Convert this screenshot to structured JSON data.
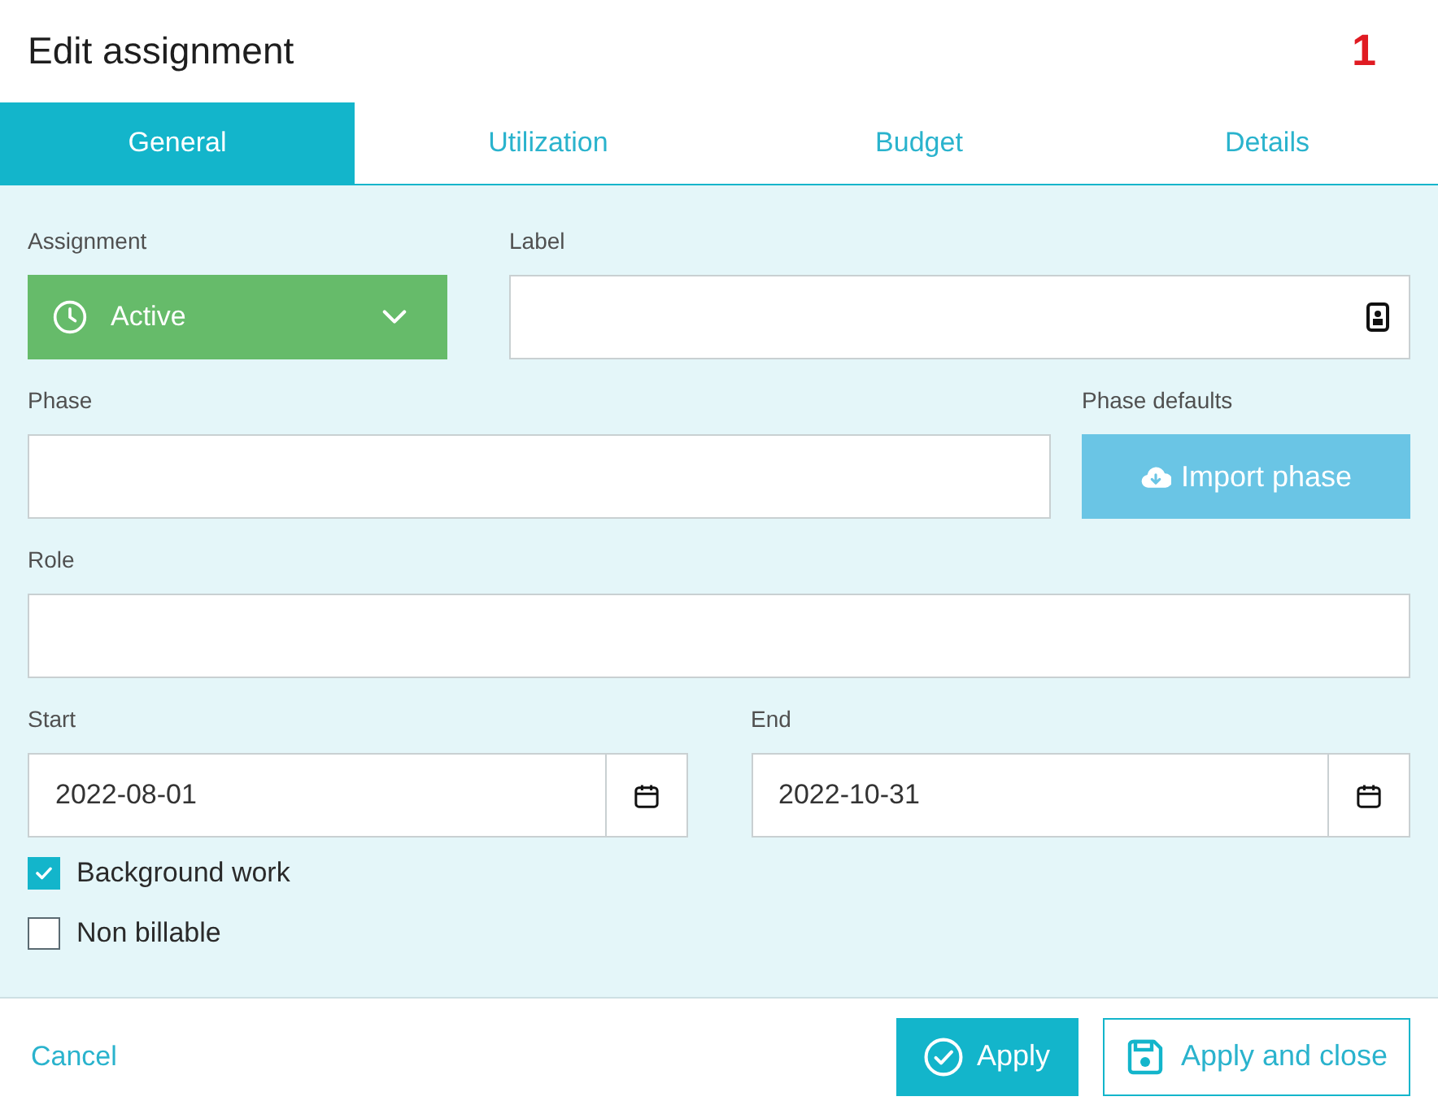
{
  "window": {
    "title": "Edit assignment",
    "marker": "1"
  },
  "tabs": [
    {
      "label": "General",
      "selected": true
    },
    {
      "label": "Utilization",
      "selected": false
    },
    {
      "label": "Budget",
      "selected": false
    },
    {
      "label": "Details",
      "selected": false
    }
  ],
  "form": {
    "assignment": {
      "label": "Assignment",
      "value": "Active"
    },
    "label_field": {
      "label": "Label"
    },
    "phase": {
      "label": "Phase"
    },
    "phase_defaults": {
      "label": "Phase defaults",
      "button": "Import phase"
    },
    "role": {
      "label": "Role"
    },
    "start": {
      "label": "Start",
      "value": "2022-08-01"
    },
    "end": {
      "label": "End",
      "value": "2022-10-31"
    },
    "checkboxes": [
      {
        "label": "Background work",
        "checked": true
      },
      {
        "label": "Non billable",
        "checked": false
      }
    ]
  },
  "footer": {
    "cancel": "Cancel",
    "apply": "Apply",
    "apply_close": "Apply and close"
  }
}
